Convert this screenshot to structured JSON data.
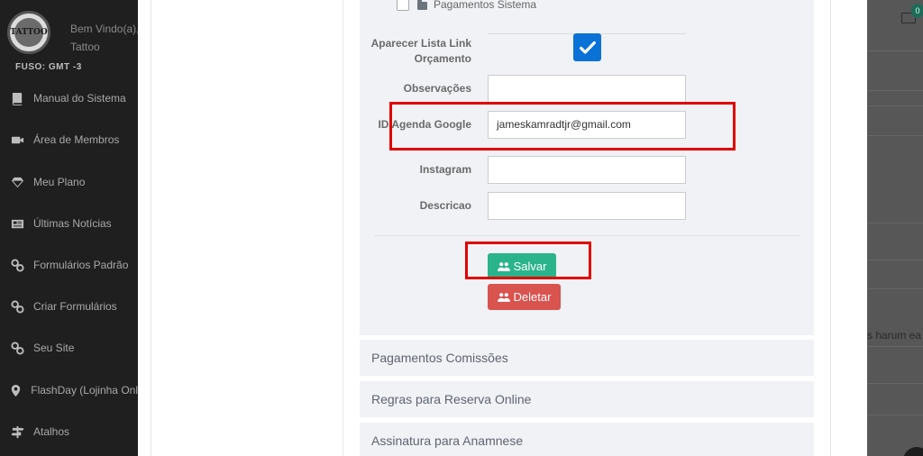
{
  "sidebar": {
    "brand_text": "TATTOO",
    "welcome": "Bem Vindo(a),",
    "username": "Tattoo",
    "timezone": "FUSO: GMT -3",
    "items": [
      {
        "label": "Manual do Sistema",
        "icon": "book-icon"
      },
      {
        "label": "Área de Membros",
        "icon": "video-camera-icon"
      },
      {
        "label": "Meu Plano",
        "icon": "diamond-icon"
      },
      {
        "label": "Últimas Notícias",
        "icon": "newspaper-icon"
      },
      {
        "label": "Formulários Padrão",
        "icon": "link-icon"
      },
      {
        "label": "Criar Formulários",
        "icon": "link-icon"
      },
      {
        "label": "Seu Site",
        "icon": "link-icon"
      },
      {
        "label": "FlashDay (Lojinha Onl",
        "icon": "map-marker-icon"
      },
      {
        "label": "Atalhos",
        "icon": "signpost-icon"
      }
    ]
  },
  "header": {
    "notification_count": "0"
  },
  "background_snippet": "s harum ea c",
  "form": {
    "permission_item": "Pagamentos Sistema",
    "fields": {
      "aparecer_lista": {
        "label": "Aparecer Lista Link Orçamento",
        "checked": true
      },
      "observacoes": {
        "label": "Observações",
        "value": ""
      },
      "id_agenda_google": {
        "label": "ID Agenda Google",
        "value": "jameskamradtjr@gmail.com"
      },
      "instagram": {
        "label": "Instagram",
        "value": ""
      },
      "descricao": {
        "label": "Descricao",
        "value": ""
      }
    },
    "save_label": "Salvar",
    "delete_label": "Deletar"
  },
  "sections": [
    "Pagamentos Comissões",
    "Regras para Reserva Online",
    "Assinatura para Anamnese"
  ],
  "colors": {
    "accent_blue": "#0a72d6",
    "save_green": "#2bb48b",
    "delete_red": "#d9534f",
    "highlight_red": "#e00000"
  }
}
